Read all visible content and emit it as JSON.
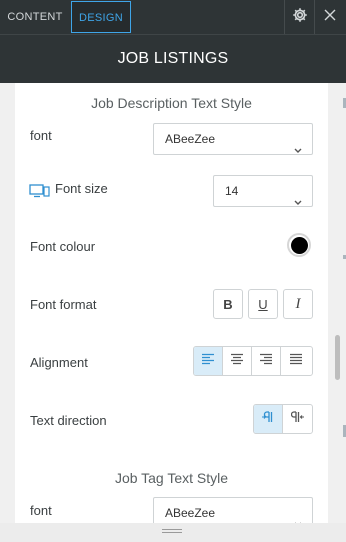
{
  "tabs": {
    "content": "CONTENT",
    "design": "DESIGN"
  },
  "header": {
    "title": "JOB LISTINGS"
  },
  "job_description": {
    "title": "Job Description Text Style",
    "font_label": "font",
    "font_value": "ABeeZee",
    "font_size_label": "Font size",
    "font_size_value": "14",
    "font_colour_label": "Font colour",
    "font_colour": "#000000",
    "font_format_label": "Font format",
    "format_bold": "B",
    "format_underline": "U",
    "format_italic": "I",
    "alignment_label": "Alignment",
    "alignment_selected": "left",
    "text_direction_label": "Text direction",
    "text_direction_selected": "ltr"
  },
  "job_tag": {
    "title": "Job Tag Text Style",
    "font_label": "font",
    "font_value": "ABeeZee"
  },
  "colors": {
    "accent": "#3fa5e8",
    "topbar": "#2e3436"
  }
}
